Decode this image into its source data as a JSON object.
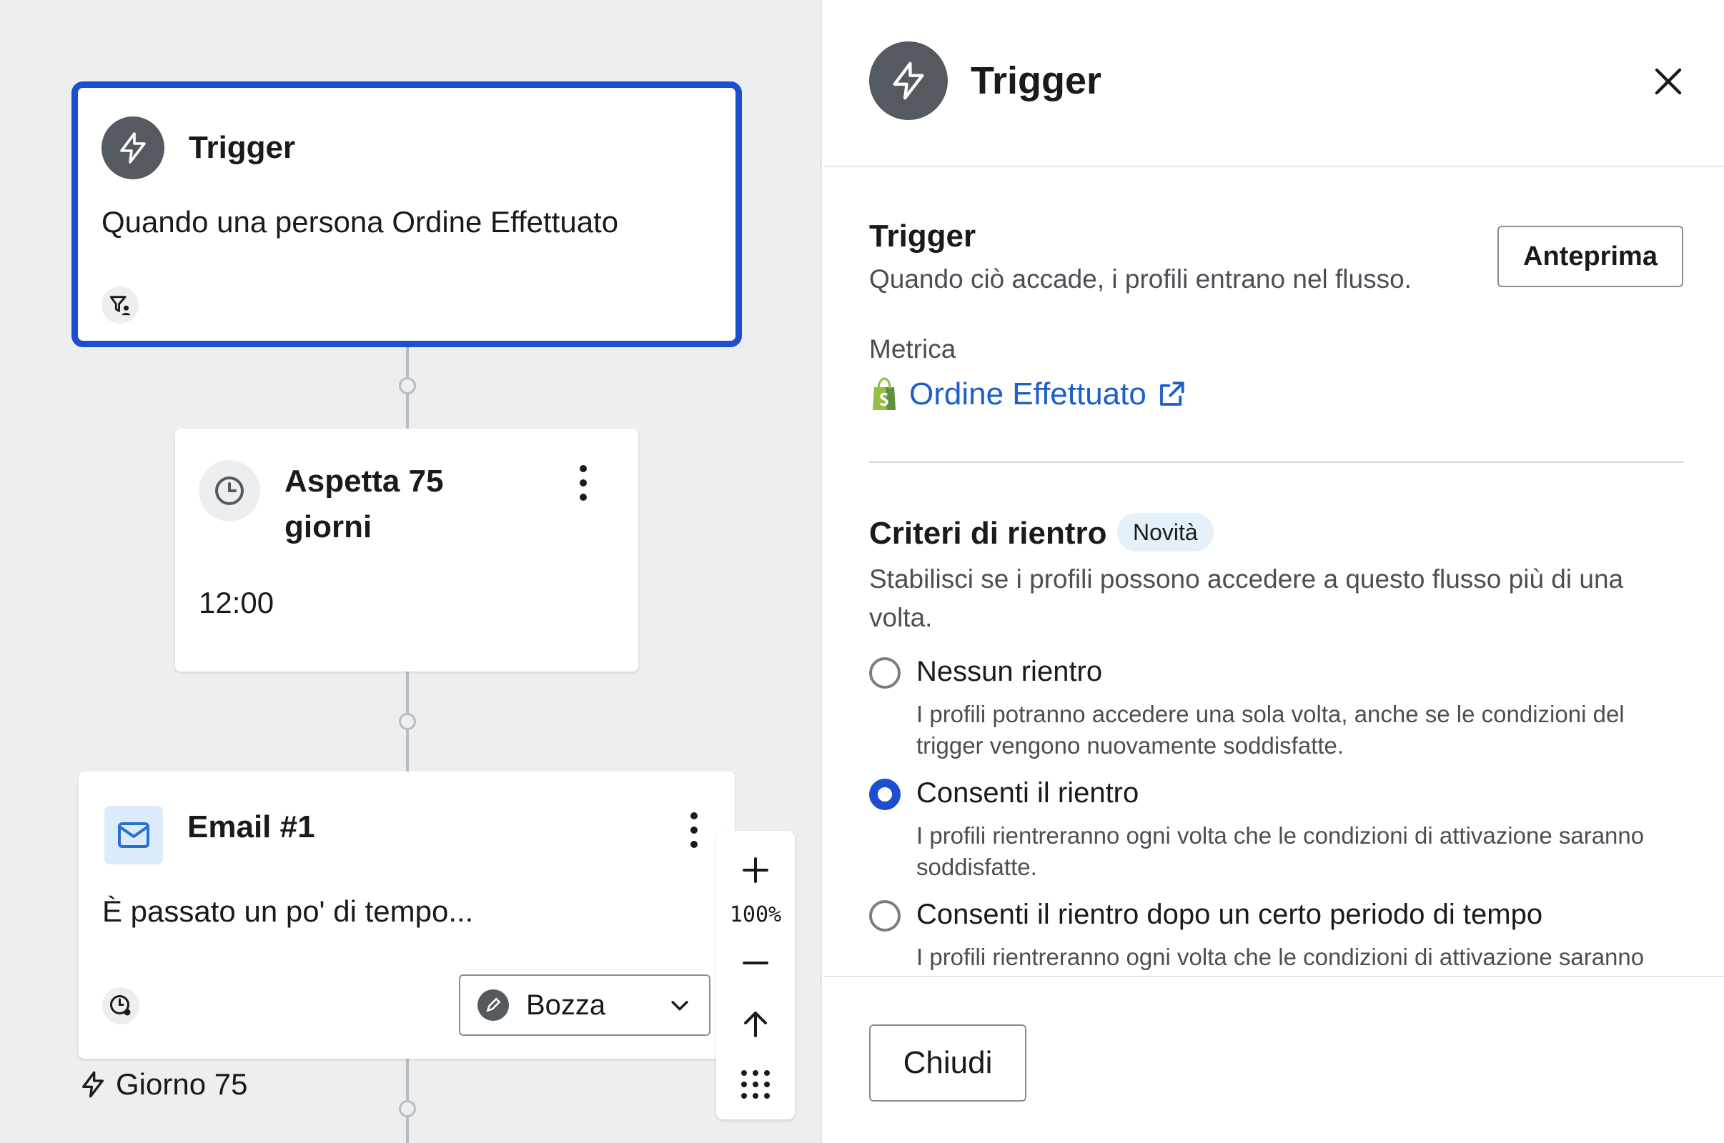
{
  "canvas": {
    "trigger_node": {
      "title": "Trigger",
      "description": "Quando una persona Ordine Effettuato"
    },
    "wait_node": {
      "title_line1": "Aspetta 75",
      "title_line2": "giorni",
      "time": "12:00"
    },
    "email_node": {
      "title": "Email #1",
      "subject": "È passato un po' di tempo...",
      "status": "Bozza"
    },
    "day_label": "Giorno 75",
    "zoom": {
      "level": "100%"
    }
  },
  "panel": {
    "title": "Trigger",
    "trigger_section": {
      "title": "Trigger",
      "description": "Quando ciò accade, i profili entrano nel flusso.",
      "preview_button": "Anteprima"
    },
    "metric": {
      "label": "Metrica",
      "value": "Ordine Effettuato"
    },
    "reentry": {
      "title": "Criteri di rientro",
      "badge": "Novità",
      "description_line1": "Stabilisci se i profili possono accedere a questo flusso più di una",
      "description_line2": "volta.",
      "options": [
        {
          "label": "Nessun rientro",
          "desc_line1": "I profili potranno accedere una sola volta, anche se le condizioni del",
          "desc_line2": "trigger vengono nuovamente soddisfatte.",
          "selected": false
        },
        {
          "label": "Consenti il rientro",
          "desc_line1": "I profili rientreranno ogni volta che le condizioni di attivazione saranno",
          "desc_line2": "soddisfatte.",
          "selected": true
        },
        {
          "label": "Consenti il rientro dopo un certo periodo di tempo",
          "desc_line1": "I profili rientreranno ogni volta che le condizioni di attivazione saranno",
          "selected": false
        }
      ]
    },
    "footer": {
      "close_button": "Chiudi"
    }
  },
  "colors": {
    "accent_blue": "#1c4fcf",
    "link_blue": "#1c5fc9",
    "canvas_bg": "#eceef0",
    "icon_dark": "#555a60",
    "badge_bg": "#e4f0fa",
    "shopify_green": "#95bf47"
  },
  "icons": [
    "lightning-icon",
    "clock-icon",
    "mail-icon",
    "filter-person-icon",
    "clock-settings-icon",
    "pencil-icon",
    "chevron-down-icon",
    "plus-icon",
    "minus-icon",
    "arrow-up-icon",
    "grid-dots-icon",
    "close-icon",
    "shopify-bag-icon",
    "external-link-icon"
  ]
}
